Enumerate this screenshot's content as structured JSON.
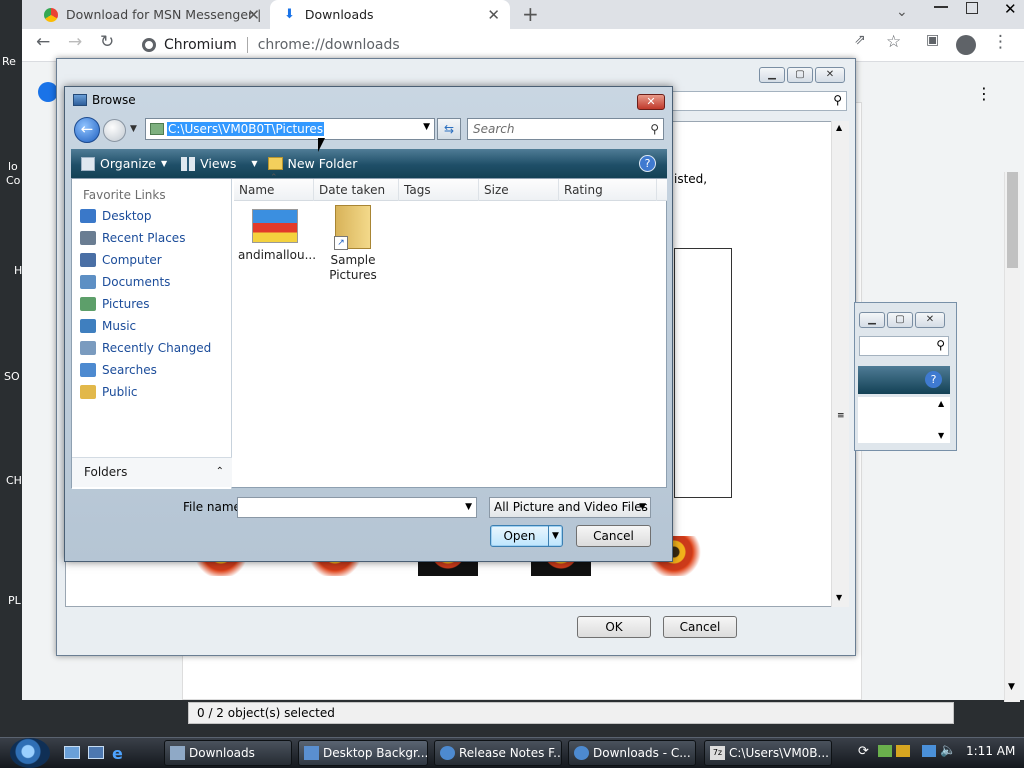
{
  "desktop": {
    "fragments": [
      "Re",
      "lo",
      "Co",
      "H",
      "SO",
      "CH",
      "PL"
    ]
  },
  "chrome": {
    "tabs": [
      {
        "label": "Download for MSN Messenger | "
      },
      {
        "label": "Downloads"
      }
    ],
    "url_scheme_label": "Chromium",
    "url": "chrome://downloads"
  },
  "desktop_background_dialog": {
    "ok_label": "OK",
    "cancel_label": "Cancel",
    "fragment_text": "isted,"
  },
  "browse_dialog": {
    "title": "Browse",
    "path": "C:\\Users\\VM0B0T\\Pictures",
    "search_placeholder": "Search",
    "toolbar": {
      "organize": "Organize",
      "views": "Views",
      "new_folder": "New Folder"
    },
    "favorite_links_header": "Favorite Links",
    "nav_items": [
      {
        "label": "Desktop",
        "icon": "desktop-icon",
        "color": "#3a78c9"
      },
      {
        "label": "Recent Places",
        "icon": "recent-places-icon",
        "color": "#6a7d92"
      },
      {
        "label": "Computer",
        "icon": "computer-icon",
        "color": "#4a6fa5"
      },
      {
        "label": "Documents",
        "icon": "documents-icon",
        "color": "#5d8fc4"
      },
      {
        "label": "Pictures",
        "icon": "pictures-icon",
        "color": "#5d9f6a"
      },
      {
        "label": "Music",
        "icon": "music-icon",
        "color": "#3f7fbf"
      },
      {
        "label": "Recently Changed",
        "icon": "recently-changed-icon",
        "color": "#7a9bbf"
      },
      {
        "label": "Searches",
        "icon": "searches-icon",
        "color": "#4d8ad0"
      },
      {
        "label": "Public",
        "icon": "public-folder-icon",
        "color": "#e2b84a"
      }
    ],
    "folders_label": "Folders",
    "columns": [
      "Name",
      "Date taken",
      "Tags",
      "Size",
      "Rating"
    ],
    "files": [
      {
        "label": "andimallou..."
      },
      {
        "label": "Sample Pictures"
      }
    ],
    "file_name_label": "File name:",
    "file_name_value": "",
    "file_type": "All Picture and Video Files",
    "open_label": "Open",
    "cancel_label": "Cancel"
  },
  "status_bar": {
    "text": "0 / 2 object(s) selected"
  },
  "taskbar": {
    "buttons": [
      {
        "label": "Downloads"
      },
      {
        "label": "Desktop Backgr..."
      },
      {
        "label": "Release Notes F..."
      },
      {
        "label": "Downloads - C..."
      },
      {
        "label": "C:\\Users\\VM0B..."
      }
    ],
    "clock": "1:11 AM"
  }
}
